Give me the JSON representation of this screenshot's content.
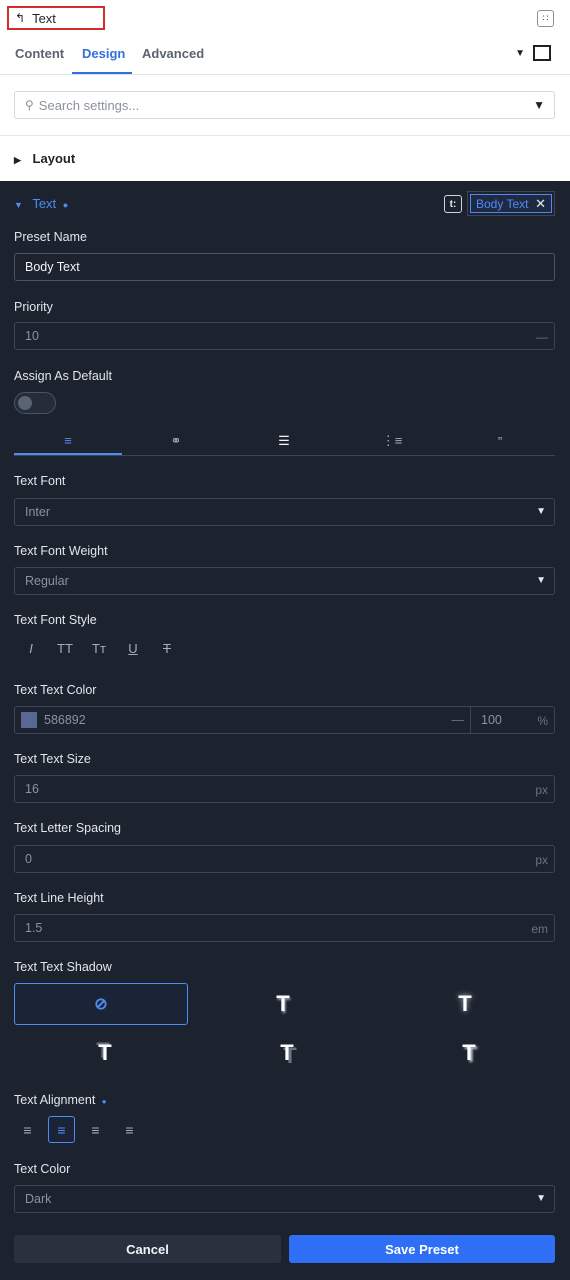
{
  "header": {
    "back_icon": "back-arrow-icon",
    "title": "Text",
    "collapse_icon": "collapse-icon"
  },
  "tabs": [
    {
      "label": "Content"
    },
    {
      "label": "Design",
      "active": true
    },
    {
      "label": "Advanced"
    }
  ],
  "search": {
    "placeholder": "Search settings..."
  },
  "layout_section": {
    "label": "Layout"
  },
  "text_section": {
    "label": "Text",
    "preset_chip": "Body Text",
    "preset_name": {
      "label": "Preset Name",
      "value": "Body Text"
    },
    "priority": {
      "label": "Priority",
      "value": "10",
      "suffix": "—"
    },
    "assign_default": {
      "label": "Assign As Default",
      "on": false
    },
    "subtabs": [
      "paragraph-icon",
      "link-icon",
      "list-icon",
      "ordered-list-icon",
      "quote-icon"
    ],
    "font": {
      "label": "Text Font",
      "value": "Inter"
    },
    "weight": {
      "label": "Text Font Weight",
      "value": "Regular"
    },
    "font_style": {
      "label": "Text Font Style",
      "options": [
        "I",
        "TT",
        "Tт",
        "U",
        "T"
      ]
    },
    "text_color": {
      "label": "Text Text Color",
      "hex": "586892",
      "swatch": "#586892",
      "opacity": "100",
      "opacity_unit": "%",
      "dash": "—"
    },
    "text_size": {
      "label": "Text Text Size",
      "value": "16",
      "unit": "px"
    },
    "letter_spacing": {
      "label": "Text Letter Spacing",
      "value": "0",
      "unit": "px"
    },
    "line_height": {
      "label": "Text Line Height",
      "value": "1.5",
      "unit": "em"
    },
    "text_shadow": {
      "label": "Text Text Shadow",
      "none_icon": "⃠",
      "sample": "T"
    },
    "alignment": {
      "label": "Text Alignment",
      "selected": "center"
    },
    "color": {
      "label": "Text Color",
      "value": "Dark"
    }
  },
  "buttons": {
    "cancel": "Cancel",
    "save": "Save Preset"
  },
  "colors": {
    "accent": "#4d8cf5",
    "panel": "#1c222e",
    "primary_button": "#2f6ff5"
  }
}
